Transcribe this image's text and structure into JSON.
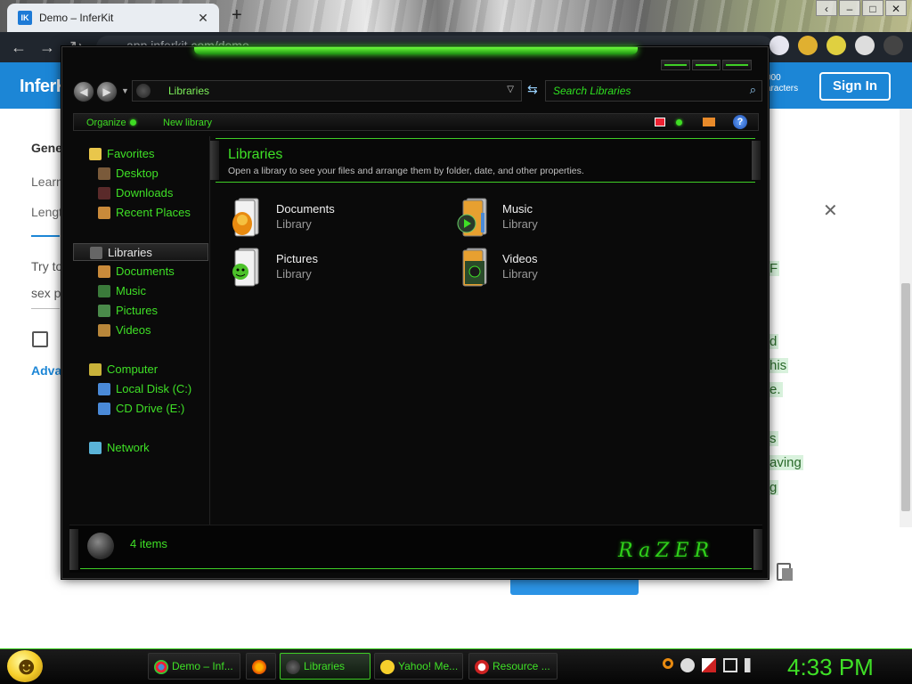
{
  "browser": {
    "tab_title": "Demo – InferKit",
    "tab_favicon": "IK",
    "new_tab_glyph": "+",
    "url": "app.inferkit.com/demo",
    "win_buttons": [
      "‹",
      "–",
      "□",
      "✕"
    ]
  },
  "website": {
    "logo": "InferK",
    "chars_line1": "000",
    "chars_line2": "aracters",
    "signin": "Sign In",
    "text_gen": "Gene",
    "text_learn": "Learn",
    "text_length": "Lengt",
    "text_tryto": "Try to",
    "text_sexp": "sex p",
    "text_adv": "Advan",
    "highlights": [
      "F",
      "d",
      "his",
      "e.",
      "s",
      "aving",
      "g"
    ],
    "close_glyph": "✕"
  },
  "explorer": {
    "address": "Libraries",
    "search_placeholder": "Search Libraries",
    "commands": {
      "organize": "Organize",
      "new_library": "New library"
    },
    "nav": [
      {
        "label": "Favorites",
        "kind": "group",
        "icon": "star-icon",
        "color": "#e9c64b"
      },
      {
        "label": "Desktop",
        "kind": "child",
        "icon": "desktop-icon",
        "color": "#7a5a3a"
      },
      {
        "label": "Downloads",
        "kind": "child",
        "icon": "downloads-icon",
        "color": "#5a2a2a"
      },
      {
        "label": "Recent Places",
        "kind": "child",
        "icon": "recent-places-icon",
        "color": "#c98a3a"
      },
      {
        "label": "Libraries",
        "kind": "group",
        "icon": "libraries-icon",
        "color": "#666666"
      },
      {
        "label": "Documents",
        "kind": "child",
        "icon": "documents-icon",
        "color": "#c98a3a"
      },
      {
        "label": "Music",
        "kind": "child",
        "icon": "music-icon",
        "color": "#3a7a3a"
      },
      {
        "label": "Pictures",
        "kind": "child",
        "icon": "pictures-icon",
        "color": "#4a8a4a"
      },
      {
        "label": "Videos",
        "kind": "child",
        "icon": "videos-icon",
        "color": "#b8863a"
      },
      {
        "label": "Computer",
        "kind": "group",
        "icon": "computer-icon",
        "color": "#c9b23a"
      },
      {
        "label": "Local Disk (C:)",
        "kind": "child",
        "icon": "disk-icon",
        "color": "#4a8ad8"
      },
      {
        "label": "CD Drive (E:)",
        "kind": "child",
        "icon": "cd-drive-icon",
        "color": "#4a8ad8"
      },
      {
        "label": "Network",
        "kind": "group",
        "icon": "network-icon",
        "color": "#5ab3d8"
      }
    ],
    "header": {
      "title": "Libraries",
      "description": "Open a library to see your files and arrange them by folder, date, and other properties."
    },
    "libraries": [
      {
        "name": "Documents",
        "kind": "Library",
        "icon": "documents-library-icon"
      },
      {
        "name": "Music",
        "kind": "Library",
        "icon": "music-library-icon"
      },
      {
        "name": "Pictures",
        "kind": "Library",
        "icon": "pictures-library-icon"
      },
      {
        "name": "Videos",
        "kind": "Library",
        "icon": "videos-library-icon"
      }
    ],
    "status": "4 items",
    "brand": "RaZER"
  },
  "taskbar": {
    "items": [
      {
        "label": "Demo – Inf...",
        "icon": "chrome-icon",
        "active": false
      },
      {
        "label": "",
        "icon": "firefox-icon",
        "active": false
      },
      {
        "label": "Libraries",
        "icon": "explorer-icon",
        "active": true
      },
      {
        "label": "Yahoo! Me...",
        "icon": "yahoo-messenger-icon",
        "active": false
      },
      {
        "label": "Resource ...",
        "icon": "resource-monitor-icon",
        "active": false
      }
    ],
    "clock": "4:33 PM"
  },
  "colors": {
    "razer_green": "#3fe026",
    "browser_blue": "#1c86d6"
  }
}
